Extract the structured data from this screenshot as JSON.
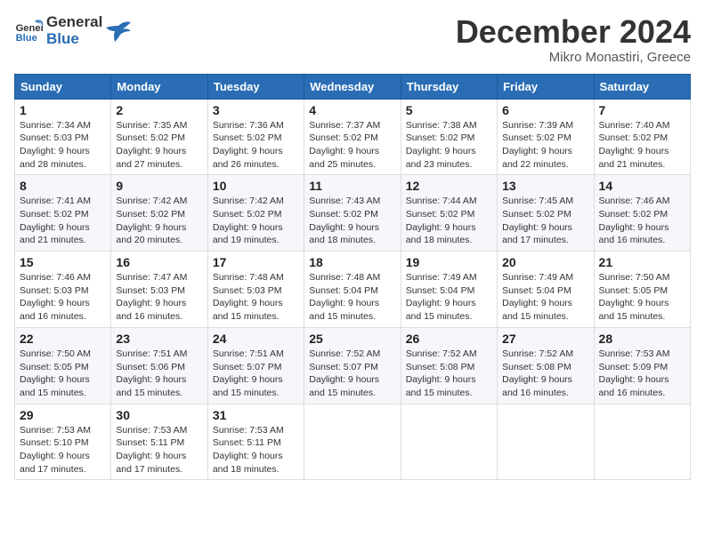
{
  "logo": {
    "line1": "General",
    "line2": "Blue"
  },
  "title": "December 2024",
  "subtitle": "Mikro Monastiri, Greece",
  "days_header": [
    "Sunday",
    "Monday",
    "Tuesday",
    "Wednesday",
    "Thursday",
    "Friday",
    "Saturday"
  ],
  "weeks": [
    [
      {
        "day": "1",
        "sunrise": "7:34 AM",
        "sunset": "5:03 PM",
        "daylight": "9 hours and 28 minutes."
      },
      {
        "day": "2",
        "sunrise": "7:35 AM",
        "sunset": "5:02 PM",
        "daylight": "9 hours and 27 minutes."
      },
      {
        "day": "3",
        "sunrise": "7:36 AM",
        "sunset": "5:02 PM",
        "daylight": "9 hours and 26 minutes."
      },
      {
        "day": "4",
        "sunrise": "7:37 AM",
        "sunset": "5:02 PM",
        "daylight": "9 hours and 25 minutes."
      },
      {
        "day": "5",
        "sunrise": "7:38 AM",
        "sunset": "5:02 PM",
        "daylight": "9 hours and 23 minutes."
      },
      {
        "day": "6",
        "sunrise": "7:39 AM",
        "sunset": "5:02 PM",
        "daylight": "9 hours and 22 minutes."
      },
      {
        "day": "7",
        "sunrise": "7:40 AM",
        "sunset": "5:02 PM",
        "daylight": "9 hours and 21 minutes."
      }
    ],
    [
      {
        "day": "8",
        "sunrise": "7:41 AM",
        "sunset": "5:02 PM",
        "daylight": "9 hours and 21 minutes."
      },
      {
        "day": "9",
        "sunrise": "7:42 AM",
        "sunset": "5:02 PM",
        "daylight": "9 hours and 20 minutes."
      },
      {
        "day": "10",
        "sunrise": "7:42 AM",
        "sunset": "5:02 PM",
        "daylight": "9 hours and 19 minutes."
      },
      {
        "day": "11",
        "sunrise": "7:43 AM",
        "sunset": "5:02 PM",
        "daylight": "9 hours and 18 minutes."
      },
      {
        "day": "12",
        "sunrise": "7:44 AM",
        "sunset": "5:02 PM",
        "daylight": "9 hours and 18 minutes."
      },
      {
        "day": "13",
        "sunrise": "7:45 AM",
        "sunset": "5:02 PM",
        "daylight": "9 hours and 17 minutes."
      },
      {
        "day": "14",
        "sunrise": "7:46 AM",
        "sunset": "5:02 PM",
        "daylight": "9 hours and 16 minutes."
      }
    ],
    [
      {
        "day": "15",
        "sunrise": "7:46 AM",
        "sunset": "5:03 PM",
        "daylight": "9 hours and 16 minutes."
      },
      {
        "day": "16",
        "sunrise": "7:47 AM",
        "sunset": "5:03 PM",
        "daylight": "9 hours and 16 minutes."
      },
      {
        "day": "17",
        "sunrise": "7:48 AM",
        "sunset": "5:03 PM",
        "daylight": "9 hours and 15 minutes."
      },
      {
        "day": "18",
        "sunrise": "7:48 AM",
        "sunset": "5:04 PM",
        "daylight": "9 hours and 15 minutes."
      },
      {
        "day": "19",
        "sunrise": "7:49 AM",
        "sunset": "5:04 PM",
        "daylight": "9 hours and 15 minutes."
      },
      {
        "day": "20",
        "sunrise": "7:49 AM",
        "sunset": "5:04 PM",
        "daylight": "9 hours and 15 minutes."
      },
      {
        "day": "21",
        "sunrise": "7:50 AM",
        "sunset": "5:05 PM",
        "daylight": "9 hours and 15 minutes."
      }
    ],
    [
      {
        "day": "22",
        "sunrise": "7:50 AM",
        "sunset": "5:05 PM",
        "daylight": "9 hours and 15 minutes."
      },
      {
        "day": "23",
        "sunrise": "7:51 AM",
        "sunset": "5:06 PM",
        "daylight": "9 hours and 15 minutes."
      },
      {
        "day": "24",
        "sunrise": "7:51 AM",
        "sunset": "5:07 PM",
        "daylight": "9 hours and 15 minutes."
      },
      {
        "day": "25",
        "sunrise": "7:52 AM",
        "sunset": "5:07 PM",
        "daylight": "9 hours and 15 minutes."
      },
      {
        "day": "26",
        "sunrise": "7:52 AM",
        "sunset": "5:08 PM",
        "daylight": "9 hours and 15 minutes."
      },
      {
        "day": "27",
        "sunrise": "7:52 AM",
        "sunset": "5:08 PM",
        "daylight": "9 hours and 16 minutes."
      },
      {
        "day": "28",
        "sunrise": "7:53 AM",
        "sunset": "5:09 PM",
        "daylight": "9 hours and 16 minutes."
      }
    ],
    [
      {
        "day": "29",
        "sunrise": "7:53 AM",
        "sunset": "5:10 PM",
        "daylight": "9 hours and 17 minutes."
      },
      {
        "day": "30",
        "sunrise": "7:53 AM",
        "sunset": "5:11 PM",
        "daylight": "9 hours and 17 minutes."
      },
      {
        "day": "31",
        "sunrise": "7:53 AM",
        "sunset": "5:11 PM",
        "daylight": "9 hours and 18 minutes."
      },
      null,
      null,
      null,
      null
    ]
  ]
}
